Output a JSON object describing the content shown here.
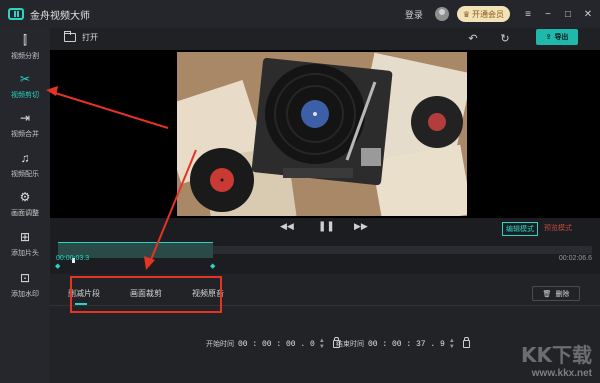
{
  "titlebar": {
    "app_title": "金舟视频大师",
    "login": "登录",
    "vip_label": "开通会员",
    "buttons": [
      "≡",
      "−",
      "□",
      "✕"
    ]
  },
  "sidebar": {
    "items": [
      {
        "label": "视频分割",
        "icon": "split-icon",
        "glyph": "⫿"
      },
      {
        "label": "视频剪切",
        "icon": "scissors-icon",
        "glyph": "✂"
      },
      {
        "label": "视频合并",
        "icon": "merge-icon",
        "glyph": "⇥"
      },
      {
        "label": "视频配乐",
        "icon": "music-note-icon",
        "glyph": "♫"
      },
      {
        "label": "画面调整",
        "icon": "adjust-icon",
        "glyph": "⚙"
      },
      {
        "label": "添加片头",
        "icon": "add-intro-icon",
        "glyph": "⊞"
      },
      {
        "label": "添加水印",
        "icon": "watermark-icon",
        "glyph": "⊡"
      }
    ],
    "active_index": 1
  },
  "header": {
    "open_label": "打开",
    "undo": "↶",
    "redo": "↻",
    "export_label": "导出"
  },
  "controls": {
    "prev": "◀◀",
    "pause": "❚❚",
    "next": "▶▶",
    "edit_mode": "编辑模式",
    "preview_mode": "预览模式"
  },
  "timeline": {
    "current_time": "00:00:03.3",
    "end_time": "00:02:06.6",
    "selection_fraction": 0.29,
    "playhead_fraction": 0.026
  },
  "panel": {
    "tabs": [
      "删减片段",
      "画面裁剪",
      "视频原音"
    ],
    "active_tab": 0,
    "delete_label": "删除",
    "start_label": "开始时间",
    "start_value": "00 : 00 : 00 . 0",
    "end_label": "结束时间",
    "end_value": "00 : 00 : 37 . 9"
  },
  "watermark": {
    "logo": "KK下载",
    "url": "www.kkx.net"
  },
  "colors": {
    "accent": "#2ad4c6",
    "annotation": "#e53324",
    "background": "#1c1d21"
  }
}
